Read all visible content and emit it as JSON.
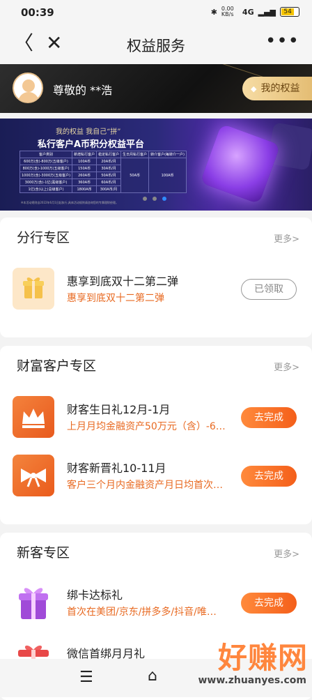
{
  "status_bar": {
    "time": "00:39",
    "net_speed": "0.00 KB/s",
    "network": "4G",
    "battery": "54"
  },
  "nav": {
    "title": "权益服务",
    "more": "•••"
  },
  "user": {
    "greeting": "尊敬的 **浩",
    "my_rights_button": "我的权益"
  },
  "banner": {
    "slogan": "我的权益  我自己“拼”",
    "title": "私行客户A币积分权益平台",
    "table_header": [
      "客户类别",
      "新增私行客户",
      "稳定私行客户",
      "生日月私行客户",
      "转介客户(每转介一户)"
    ],
    "table_rows": [
      [
        "600万(含)-800万(五级客户)",
        "100A币",
        "20A币/月"
      ],
      [
        "800万(含)-1000万(五级客户)",
        "150A币",
        "30A币/月"
      ],
      [
        "1000万(含)-3000万(五级客户)",
        "260A币",
        "50A币/月"
      ],
      [
        "3000万(含)-1亿(黑级客户)",
        "360A币",
        "60A币/月"
      ],
      [
        "1亿(含)以上(总级客户)",
        "1800A币",
        "300A币/月"
      ]
    ],
    "birthday_value": "50A币",
    "referral_value": "100A币",
    "note": "※本活动规则自2022年6月1日起执行,具体活动规则请咨询您的专属理财经理。",
    "active_dot": 2
  },
  "sections": [
    {
      "title": "分行专区",
      "more": "更多>",
      "items": [
        {
          "icon": "gift-box-icon",
          "title": "惠享到底双十二第二弹",
          "subtitle": "惠享到底双十二第二弹",
          "button": "已领取",
          "state": "done"
        }
      ]
    },
    {
      "title": "财富客户专区",
      "more": "更多>",
      "items": [
        {
          "icon": "crown-icon",
          "title": "财客生日礼12月-1月",
          "subtitle": "上月月均金融资产50万元（含）-6…",
          "button": "去完成",
          "state": "todo"
        },
        {
          "icon": "bow-icon",
          "title": "财客新晋礼10-11月",
          "subtitle": "客户三个月内金融资产月日均首次…",
          "button": "去完成",
          "state": "todo"
        }
      ]
    },
    {
      "title": "新客专区",
      "more": "更多>",
      "items": [
        {
          "icon": "purple-gift-icon",
          "title": "绑卡达标礼",
          "subtitle": "首次在美团/京东/拼多多/抖音/唯…",
          "button": "去完成",
          "state": "todo"
        },
        {
          "icon": "red-gift-icon",
          "title": "微信首绑月月礼",
          "subtitle": "",
          "button": "",
          "state": "todo"
        }
      ]
    }
  ],
  "watermark": {
    "text": "好赚网",
    "url": "www.zhuanyes.com"
  },
  "colors": {
    "accent": "#f45f1a",
    "link_orange": "#e86a22",
    "gold": "#e4bd74"
  }
}
